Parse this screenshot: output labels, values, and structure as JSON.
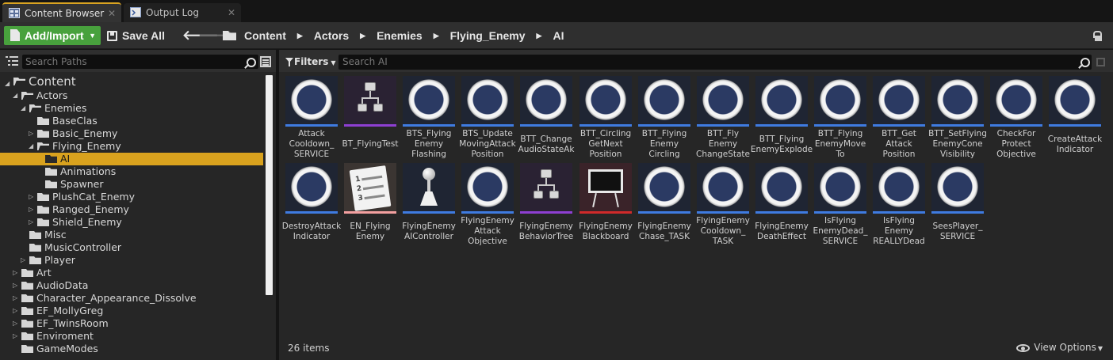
{
  "tabs": [
    {
      "label": "Content Browser",
      "icon": "content-browser-icon",
      "active": true
    },
    {
      "label": "Output Log",
      "icon": "output-log-icon",
      "active": false
    }
  ],
  "toolbar": {
    "add_import": "Add/Import",
    "save_all": "Save All",
    "breadcrumbs": [
      "Content",
      "Actors",
      "Enemies",
      "Flying_Enemy",
      "AI"
    ]
  },
  "sources": {
    "search_placeholder": "Search Paths",
    "tree": [
      {
        "label": "Content",
        "depth": 0,
        "expanded": true,
        "arrow": true
      },
      {
        "label": "Actors",
        "depth": 1,
        "expanded": true,
        "arrow": true
      },
      {
        "label": "Enemies",
        "depth": 2,
        "expanded": true,
        "arrow": true
      },
      {
        "label": "BaseClas",
        "depth": 3,
        "expanded": false,
        "arrow": false
      },
      {
        "label": "Basic_Enemy",
        "depth": 3,
        "expanded": false,
        "arrow": true
      },
      {
        "label": "Flying_Enemy",
        "depth": 3,
        "expanded": true,
        "arrow": true
      },
      {
        "label": "AI",
        "depth": 4,
        "expanded": false,
        "arrow": false,
        "selected": true
      },
      {
        "label": "Animations",
        "depth": 4,
        "expanded": false,
        "arrow": false
      },
      {
        "label": "Spawner",
        "depth": 4,
        "expanded": false,
        "arrow": false
      },
      {
        "label": "PlushCat_Enemy",
        "depth": 3,
        "expanded": false,
        "arrow": true
      },
      {
        "label": "Ranged_Enemy",
        "depth": 3,
        "expanded": false,
        "arrow": true
      },
      {
        "label": "Shield_Enemy",
        "depth": 3,
        "expanded": false,
        "arrow": true
      },
      {
        "label": "Misc",
        "depth": 2,
        "expanded": false,
        "arrow": false
      },
      {
        "label": "MusicController",
        "depth": 2,
        "expanded": false,
        "arrow": false
      },
      {
        "label": "Player",
        "depth": 2,
        "expanded": false,
        "arrow": true
      },
      {
        "label": "Art",
        "depth": 1,
        "expanded": false,
        "arrow": true
      },
      {
        "label": "AudioData",
        "depth": 1,
        "expanded": false,
        "arrow": true
      },
      {
        "label": "Character_Appearance_Dissolve",
        "depth": 1,
        "expanded": false,
        "arrow": true
      },
      {
        "label": "EF_MollyGreg",
        "depth": 1,
        "expanded": false,
        "arrow": true
      },
      {
        "label": "EF_TwinsRoom",
        "depth": 1,
        "expanded": false,
        "arrow": true
      },
      {
        "label": "Enviroment",
        "depth": 1,
        "expanded": false,
        "arrow": true
      },
      {
        "label": "GameModes",
        "depth": 1,
        "expanded": false,
        "arrow": false
      }
    ]
  },
  "assets": {
    "filters_label": "Filters",
    "search_placeholder": "Search AI",
    "items": [
      {
        "name": "Attack\nCooldown_\nSERVICE",
        "kind": "task"
      },
      {
        "name": "BT_FlyingTest",
        "kind": "behavior-tree"
      },
      {
        "name": "BTS_Flying\nEnemy\nFlashing",
        "kind": "task"
      },
      {
        "name": "BTS_Update\nMovingAttack\nPosition",
        "kind": "task"
      },
      {
        "name": "BTT_Change\nAudioStateAk",
        "kind": "task"
      },
      {
        "name": "BTT_Circling\nGetNext\nPosition",
        "kind": "task"
      },
      {
        "name": "BTT_Flying\nEnemy\nCircling",
        "kind": "task"
      },
      {
        "name": "BTT_Fly\nEnemy\nChangeState",
        "kind": "task"
      },
      {
        "name": "BTT_Flying\nEnemyExplode",
        "kind": "task"
      },
      {
        "name": "BTT_Flying\nEnemyMove\nTo",
        "kind": "task"
      },
      {
        "name": "BTT_Get\nAttack\nPosition",
        "kind": "task"
      },
      {
        "name": "BTT_SetFlying\nEnemyCone\nVisibility",
        "kind": "task"
      },
      {
        "name": "CheckFor\nProtect\nObjective",
        "kind": "task"
      },
      {
        "name": "CreateAttack\nIndicator",
        "kind": "task"
      },
      {
        "name": "DestroyAttack\nIndicator",
        "kind": "task"
      },
      {
        "name": "EN_Flying\nEnemy",
        "kind": "enum"
      },
      {
        "name": "FlyingEnemy\nAIController",
        "kind": "ai-controller"
      },
      {
        "name": "FlyingEnemy\nAttack\nObjective",
        "kind": "task"
      },
      {
        "name": "FlyingEnemy\nBehaviorTree",
        "kind": "behavior-tree"
      },
      {
        "name": "FlyingEnemy\nBlackboard",
        "kind": "blackboard"
      },
      {
        "name": "FlyingEnemy\nChase_TASK",
        "kind": "task"
      },
      {
        "name": "FlyingEnemy\nCooldown_\nTASK",
        "kind": "task"
      },
      {
        "name": "FlyingEnemy\nDeathEffect",
        "kind": "task"
      },
      {
        "name": "IsFlying\nEnemyDead_\nSERVICE",
        "kind": "task"
      },
      {
        "name": "IsFlying\nEnemy\nREALLYDead",
        "kind": "task"
      },
      {
        "name": "SeesPlayer_\nSERVICE",
        "kind": "task"
      }
    ],
    "item_count": "26 items",
    "view_options": "View Options"
  }
}
